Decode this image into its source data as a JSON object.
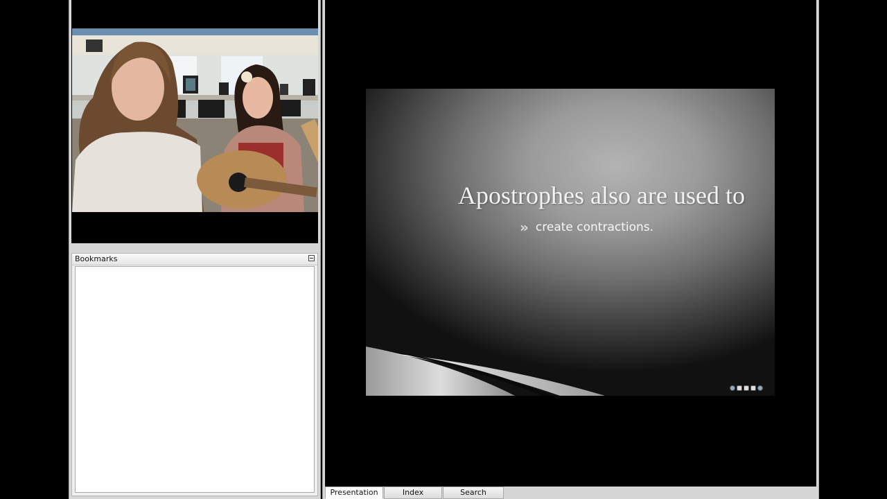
{
  "bookmarks": {
    "title": "Bookmarks",
    "minimize_icon": "minimize-icon"
  },
  "video": {
    "content": "webcam-video"
  },
  "slide": {
    "title": "Apostrophes also are used to",
    "bullet_icon": "double-chevron-icon",
    "bullet_glyph": "»",
    "bullet_text": "create contractions."
  },
  "player_controls": [
    "rewind-icon",
    "pause-icon",
    "stop-icon",
    "forward-icon",
    "info-icon"
  ],
  "tabs": [
    {
      "label": "Presentation",
      "active": true
    },
    {
      "label": "Index",
      "active": false
    },
    {
      "label": "Search",
      "active": false
    }
  ],
  "colors": {
    "frame": "#d6d6d6",
    "background": "#000000",
    "slide_text": "#f3f3f3"
  }
}
